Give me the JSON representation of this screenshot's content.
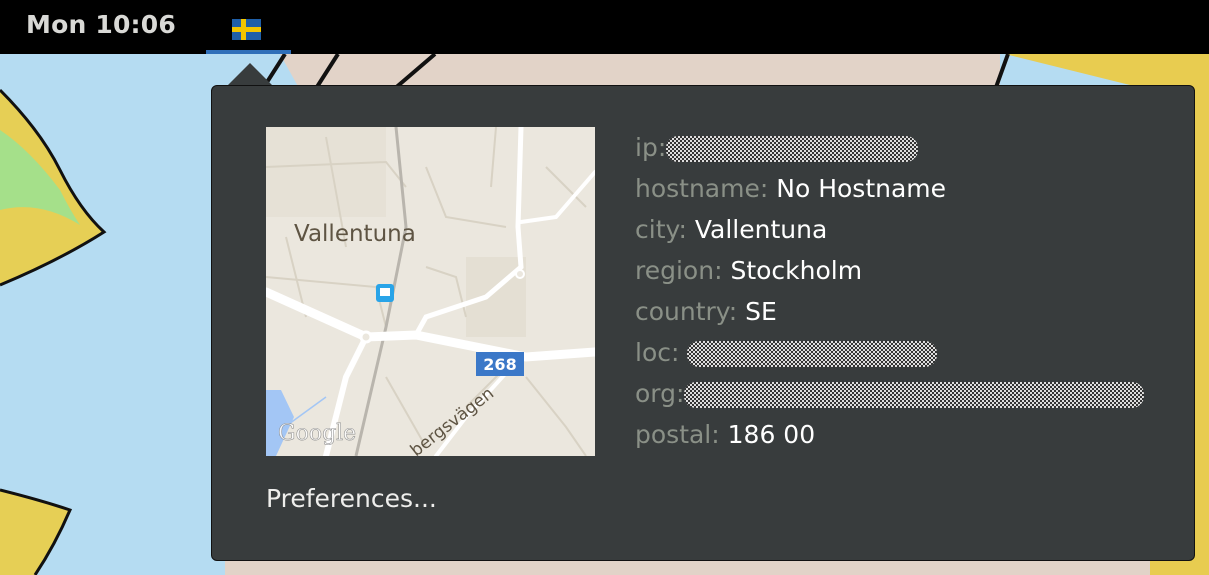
{
  "topbar": {
    "clock": "Mon 10:06",
    "indicator_icon": "sweden-flag-icon",
    "colors": {
      "background": "#000000",
      "active_underline": "#2f6fb9"
    }
  },
  "popup": {
    "map": {
      "place_label": "Vallentuna",
      "road_shield": "268",
      "street_label": "bergsvägen",
      "attribution": "Google",
      "transit_icon": "bus-stop-icon"
    },
    "info": [
      {
        "key": "ip:",
        "value": "",
        "redacted": true
      },
      {
        "key": "hostname:",
        "value": "No Hostname",
        "redacted": false
      },
      {
        "key": "city:",
        "value": "Vallentuna",
        "redacted": false
      },
      {
        "key": "region:",
        "value": "Stockholm",
        "redacted": false
      },
      {
        "key": "country:",
        "value": "SE",
        "redacted": false
      },
      {
        "key": "loc:",
        "value": "",
        "redacted": true
      },
      {
        "key": "org:",
        "value": "",
        "redacted": true
      },
      {
        "key": "postal:",
        "value": "186 00",
        "redacted": false
      }
    ],
    "preferences_label": "Preferences...",
    "colors": {
      "background": "#383c3d",
      "key_text": "#8a9087",
      "value_text": "#ffffff"
    }
  }
}
